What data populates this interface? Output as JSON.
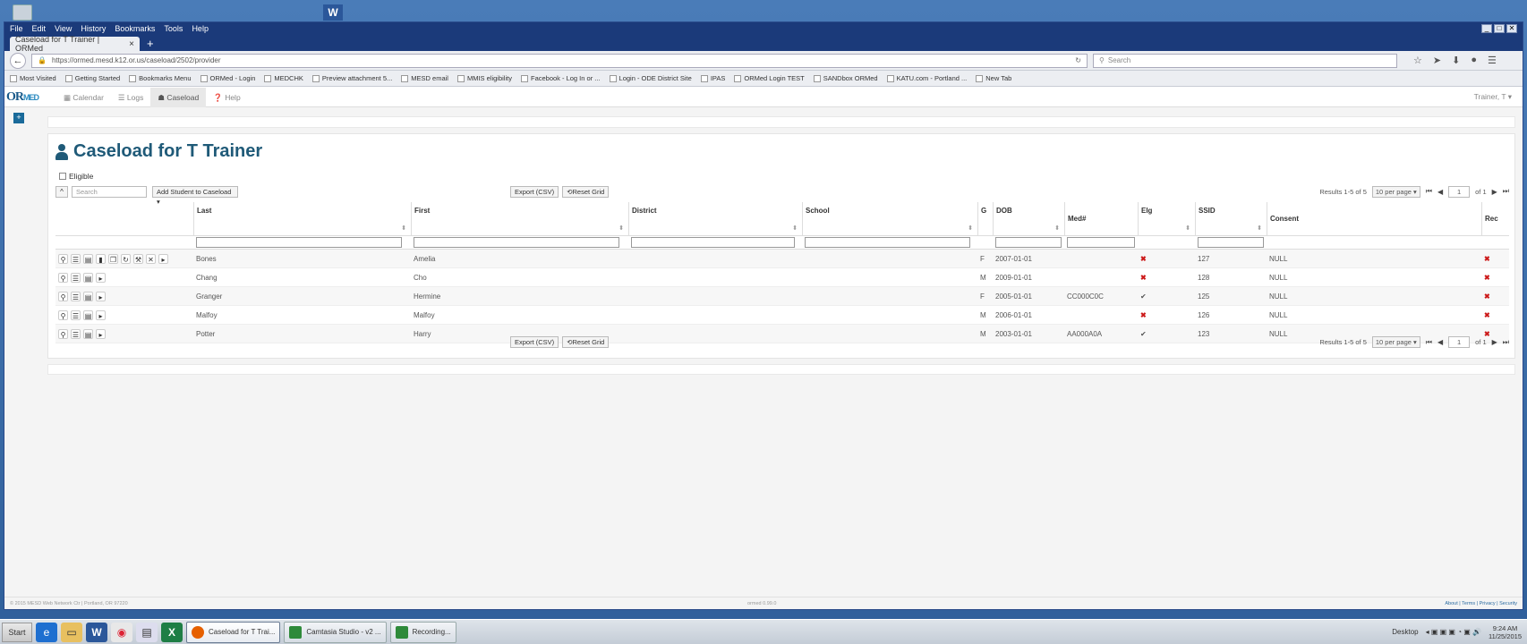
{
  "browser": {
    "menu": [
      "File",
      "Edit",
      "View",
      "History",
      "Bookmarks",
      "Tools",
      "Help"
    ],
    "tab_title": "Caseload for T Trainer | ORMed",
    "url": "https://ormed.mesd.k12.or.us/caseload/2502/provider",
    "search_placeholder": "Search",
    "bookmarks": [
      "Most Visited",
      "Getting Started",
      "Bookmarks Menu",
      "ORMed - Login",
      "MEDCHK",
      "Preview attachment 5...",
      "MESD email",
      "MMIS eligibility",
      "Facebook - Log In or ...",
      "Login - ODE District Site",
      "IPAS",
      "ORMed Login TEST",
      "SANDbox ORMed",
      "KATU.com - Portland ...",
      "New Tab"
    ]
  },
  "app": {
    "logo": "OR",
    "logo_sub": "MED",
    "nav": [
      "Calendar",
      "Logs",
      "Caseload",
      "Help"
    ],
    "user": "Trainer, T ▾",
    "title": "Caseload for T Trainer",
    "eligible_label": "Eligible",
    "search_placeholder": "Search",
    "add_student": "Add Student to Caseload ▾",
    "export_csv": "Export (CSV)",
    "reset_grid": "Reset Grid",
    "results": "Results 1-5 of 5",
    "per_page": "10 per page ▾",
    "page": "1",
    "of_pages": "of 1",
    "columns": [
      "Last",
      "First",
      "District",
      "School",
      "G",
      "DOB",
      "Med#",
      "Elg",
      "SSID",
      "Consent",
      "Rec"
    ],
    "rows": [
      {
        "last": "Bones",
        "first": "Amelia",
        "district": "",
        "school": "",
        "g": "F",
        "dob": "2007-01-01",
        "med": "",
        "elg": "✖",
        "ssid": "127",
        "consent": "NULL",
        "rec": "✖"
      },
      {
        "last": "Chang",
        "first": "Cho",
        "district": "",
        "school": "",
        "g": "M",
        "dob": "2009-01-01",
        "med": "",
        "elg": "✖",
        "ssid": "128",
        "consent": "NULL",
        "rec": "✖"
      },
      {
        "last": "Granger",
        "first": "Hermine",
        "district": "",
        "school": "",
        "g": "F",
        "dob": "2005-01-01",
        "med": "CC000C0C",
        "elg": "✔",
        "ssid": "125",
        "consent": "NULL",
        "rec": "✖"
      },
      {
        "last": "Malfoy",
        "first": "Malfoy",
        "district": "",
        "school": "",
        "g": "M",
        "dob": "2006-01-01",
        "med": "",
        "elg": "✖",
        "ssid": "126",
        "consent": "NULL",
        "rec": "✖"
      },
      {
        "last": "Potter",
        "first": "Harry",
        "district": "",
        "school": "",
        "g": "M",
        "dob": "2003-01-01",
        "med": "AA000A0A",
        "elg": "✔",
        "ssid": "123",
        "consent": "NULL",
        "rec": "✖"
      }
    ],
    "footer_left": "© 2015 MESD Web Network Ctr | Portland, OR 97220",
    "footer_mid": "ormed 0.99.0",
    "footer_right": "About | Terms | Privacy | Security"
  },
  "taskbar": {
    "start": "Start",
    "tasks": [
      "Caseload for T Trai...",
      "Camtasia Studio - v2 ...",
      "Recording..."
    ],
    "desktop": "Desktop",
    "time": "9:24 AM",
    "date": "11/25/2015"
  },
  "colors": {
    "title": "#1f5a78",
    "titlebar": "#1b3a7a",
    "error": "#cc1a1a"
  }
}
